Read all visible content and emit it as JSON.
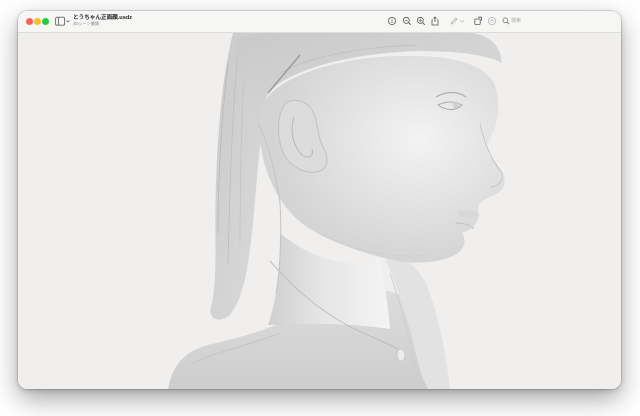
{
  "window": {
    "title": "とうちゃん正面顔.usdz",
    "subtitle": "3Dシーン書類"
  },
  "toolbar": {
    "search_placeholder": "検索",
    "icons": [
      "sidebar-icon",
      "info-icon",
      "zoom-out-icon",
      "zoom-in-icon",
      "share-icon",
      "markup-icon",
      "rotate-icon",
      "annotate-icon",
      "search-icon"
    ]
  },
  "colors": {
    "window_bg": "#f0efed",
    "titlebar_bg": "#f6f6f5",
    "close": "#fe5f57",
    "minimize": "#febc2e",
    "maximize": "#28c840"
  },
  "viewer": {
    "content": "3D model of a human bust in profile"
  }
}
